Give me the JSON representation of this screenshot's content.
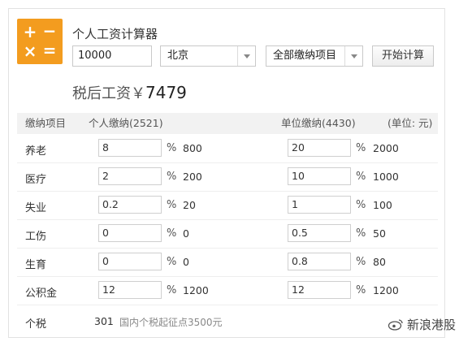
{
  "app": {
    "title": "个人工资计算器"
  },
  "form": {
    "salary_value": "10000",
    "city_value": "北京",
    "items_value": "全部缴纳项目",
    "calc_label": "开始计算"
  },
  "result": {
    "label": "税后工资￥",
    "amount": "7479"
  },
  "table": {
    "headers": {
      "item": "缴纳项目",
      "personal": "个人缴纳(2521)",
      "company": "单位缴纳(4430)",
      "unit": "(单位: 元)"
    },
    "pct_sign": "%",
    "rows": [
      {
        "name": "养老",
        "personal_rate": "8",
        "personal_amount": "800",
        "company_rate": "20",
        "company_amount": "2000"
      },
      {
        "name": "医疗",
        "personal_rate": "2",
        "personal_amount": "200",
        "company_rate": "10",
        "company_amount": "1000"
      },
      {
        "name": "失业",
        "personal_rate": "0.2",
        "personal_amount": "20",
        "company_rate": "1",
        "company_amount": "100"
      },
      {
        "name": "工伤",
        "personal_rate": "0",
        "personal_amount": "0",
        "company_rate": "0.5",
        "company_amount": "50"
      },
      {
        "name": "生育",
        "personal_rate": "0",
        "personal_amount": "0",
        "company_rate": "0.8",
        "company_amount": "80"
      },
      {
        "name": "公积金",
        "personal_rate": "12",
        "personal_amount": "1200",
        "company_rate": "12",
        "company_amount": "1200"
      }
    ],
    "tax": {
      "name": "个税",
      "amount": "301",
      "note": "国内个税起征点3500元"
    }
  },
  "watermark": {
    "text": "新浪港股"
  },
  "colors": {
    "logo_bg": "#f39c1f",
    "header_bg": "#f2f2f2"
  },
  "icons": {
    "logo": "calculator-icon",
    "watermark": "weibo-icon"
  }
}
